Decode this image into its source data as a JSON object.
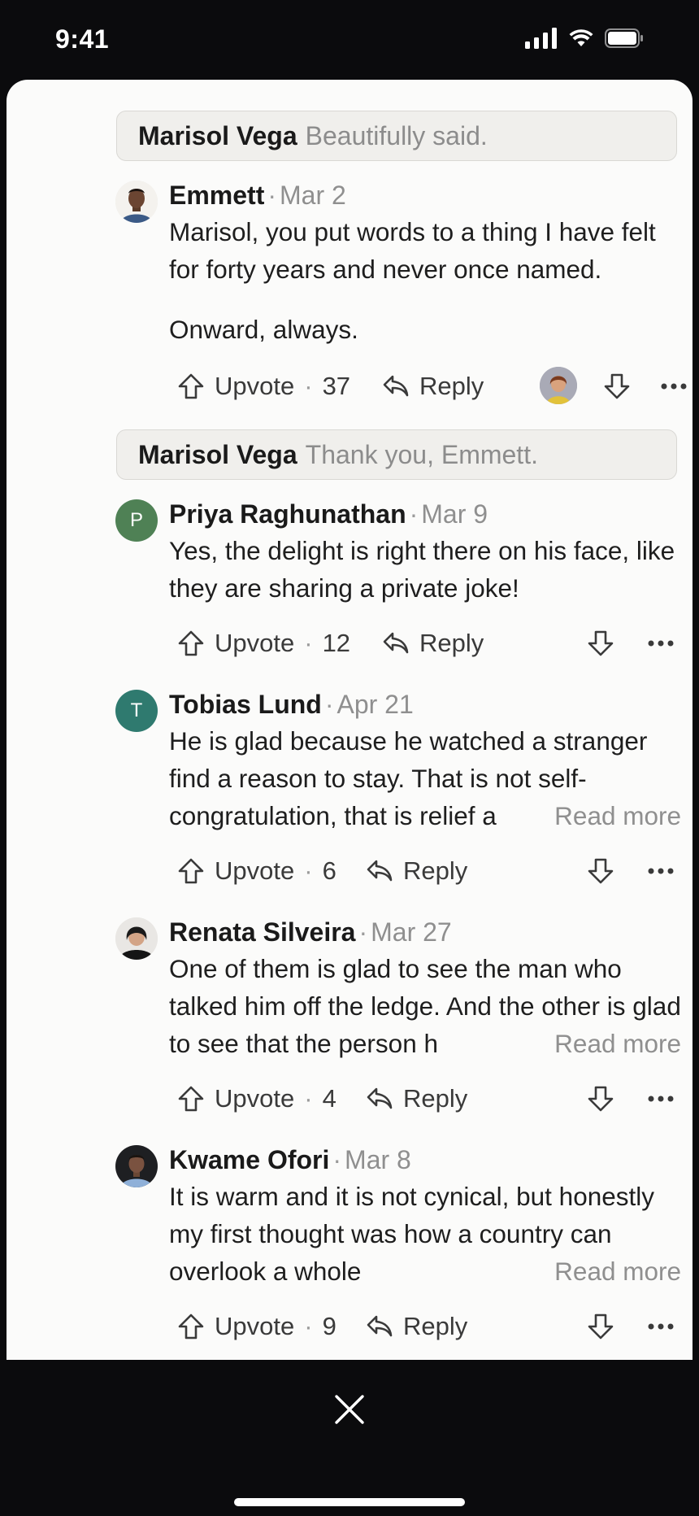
{
  "status_bar": {
    "time": "9:41",
    "icons": [
      "cellular-signal-icon",
      "wifi-icon",
      "battery-icon"
    ]
  },
  "thread": [
    {
      "quote": {
        "author": "Marisol Vega",
        "text": "Beautifully said."
      },
      "name": "Emmett",
      "date": "Mar 2",
      "avatar": "photo",
      "paragraphs": [
        "Marisol, you put words to a thing I have felt for forty years and never once named.",
        "Onward, always."
      ],
      "upvote_label": "Upvote",
      "upvotes": "37",
      "reply_label": "Reply",
      "liked_by_avatar": true
    },
    {
      "quote": {
        "author": "Marisol Vega",
        "text": "Thank you, Emmett."
      },
      "name": "Priya Raghunathan",
      "date": "Mar 9",
      "avatar_letter": "P",
      "avatar_color": "#4f8155",
      "text": "Yes, the delight is right there on his face, like they are sharing a private joke!",
      "upvote_label": "Upvote",
      "upvotes": "12",
      "reply_label": "Reply"
    },
    {
      "name": "Tobias Lund",
      "date": "Apr 21",
      "avatar_letter": "T",
      "avatar_color": "#2f7a6f",
      "text": "He is glad because he watched a stranger find a reason to stay. That is not self-congratulation, that is relief a",
      "read_more": "Read more",
      "upvote_label": "Upvote",
      "upvotes": "6",
      "reply_label": "Reply"
    },
    {
      "name": "Renata Silveira",
      "date": "Mar 27",
      "avatar": "photo",
      "text": "One of them is glad to see the man who talked him off the ledge. And the other is glad to see that the person h",
      "read_more": "Read more",
      "upvote_label": "Upvote",
      "upvotes": "4",
      "reply_label": "Reply"
    },
    {
      "name": "Kwame Ofori",
      "date": "Mar 8",
      "avatar": "photo",
      "text": "It is warm and it is not cynical, but honestly my first thought was how a country can overlook a whole",
      "read_more": "Read more",
      "upvote_label": "Upvote",
      "upvotes": "9",
      "reply_label": "Reply"
    }
  ],
  "colors": {
    "sheet_background": "#fbfbfa",
    "screen_background": "#0b0b0d",
    "quote_background": "#f0efec",
    "meta_gray": "#8f8f8f"
  },
  "footer": {
    "close_icon": "close-icon"
  }
}
